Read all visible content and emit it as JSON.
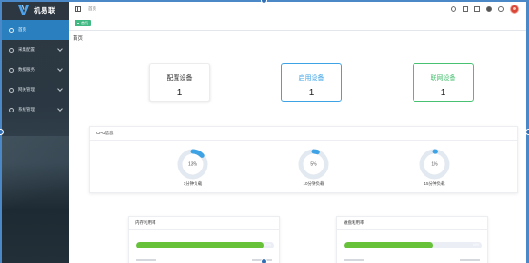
{
  "app": {
    "name": "机易联"
  },
  "sidebar": {
    "items": [
      {
        "label": "首页",
        "active": true,
        "has_children": false
      },
      {
        "label": "采集配置",
        "active": false,
        "has_children": true
      },
      {
        "label": "数据服务",
        "active": false,
        "has_children": true
      },
      {
        "label": "网关管理",
        "active": false,
        "has_children": true
      },
      {
        "label": "系统管理",
        "active": false,
        "has_children": true
      }
    ]
  },
  "header": {
    "breadcrumb": "首页",
    "icons": [
      "search-icon",
      "fullscreen-icon",
      "font-size-icon",
      "github-icon",
      "help-icon",
      "user-avatar"
    ]
  },
  "tags": [
    {
      "label": "首页"
    }
  ],
  "page": {
    "title": "首页"
  },
  "stats": [
    {
      "label": "配置设备",
      "value": "1",
      "color": "#333333"
    },
    {
      "label": "启用设备",
      "value": "1",
      "color": "#3ea3e5"
    },
    {
      "label": "联网设备",
      "value": "1",
      "color": "#48c272"
    }
  ],
  "cpu": {
    "title": "CPU信息",
    "gauges": [
      {
        "percent_text": "13%",
        "percent": 13,
        "caption": "1分钟负载"
      },
      {
        "percent_text": "5%",
        "percent": 5,
        "caption": "10分钟负载"
      },
      {
        "percent_text": "1%",
        "percent": 1,
        "caption": "15分钟负载"
      }
    ]
  },
  "memory": {
    "title": "内存利用率",
    "percent_text": "93%",
    "percent": 93
  },
  "disk": {
    "title": "磁盘利用率",
    "percent_text": "64%",
    "percent": 64
  },
  "colors": {
    "accent": "#2a7fbf",
    "green": "#67c23a",
    "blue": "#3ea3e5",
    "gauge_track": "#e3e9f1",
    "gauge_fill": "#3ea3e5"
  }
}
